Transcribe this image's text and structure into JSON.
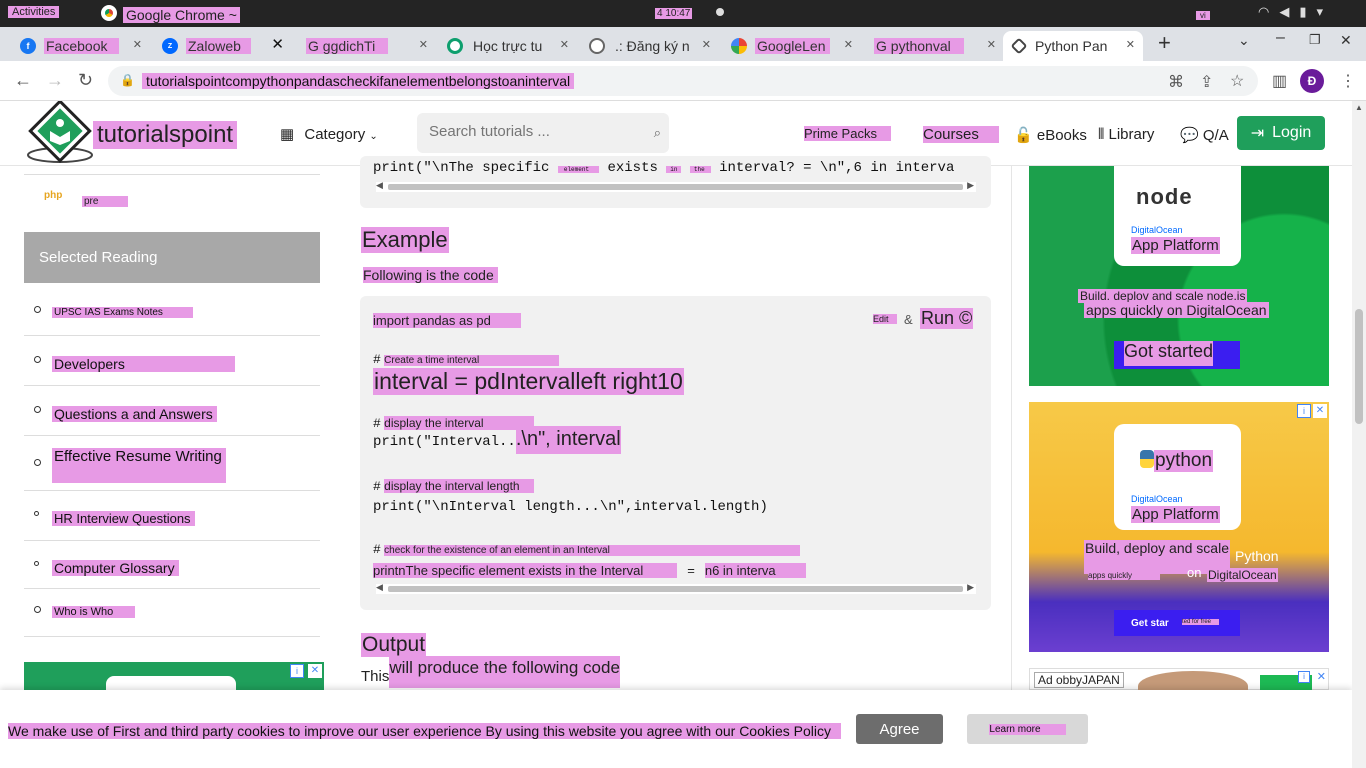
{
  "system": {
    "activities": "Activities",
    "app_name": "Google Chrome ~",
    "clock": "4 10:47",
    "keyboard": "vi"
  },
  "tabs": [
    {
      "title": "Facebook",
      "icon": "facebook-icon",
      "color": "#1877f2",
      "glyph": "f"
    },
    {
      "title": "Zaloweb",
      "icon": "zalo-icon",
      "color": "#0068ff",
      "glyph": "Z"
    },
    {
      "title": "G ggdichTi",
      "icon": "google-translate-icon",
      "color": "#4285f4",
      "glyph": ""
    },
    {
      "title": "Học trực tu",
      "icon": "course-site-icon",
      "color": "#0e9f6e",
      "glyph": ""
    },
    {
      "title": ".: Đăng ký n",
      "icon": "globe-icon",
      "color": "#666666",
      "glyph": ""
    },
    {
      "title": "GoogleLen",
      "icon": "google-lens-icon",
      "color": "#ea4335",
      "glyph": ""
    },
    {
      "title": "G pythonval",
      "icon": "google-search-icon",
      "color": "#4285f4",
      "glyph": ""
    },
    {
      "title": "Python Pan",
      "icon": "tutorialspoint-icon",
      "color": "#444444",
      "glyph": ""
    }
  ],
  "address": {
    "url": "tutorialspointcompythonpandascheckifanelementbelongstoaninterval",
    "avatar_letter": "Đ"
  },
  "header": {
    "brand": "tutorialspoint",
    "category": "Category",
    "search_placeholder": "Search tutorials ...",
    "menu": {
      "prime_packs": "Prime Packs",
      "courses": "Courses",
      "ebooks": "eBooks",
      "library": "Library",
      "qa": "Q/A",
      "login": "Login"
    }
  },
  "sidebar": {
    "php_label": "php",
    "pre_label": "pre",
    "heading": "Selected Reading",
    "items": [
      {
        "label": "UPSC IAS Exams Notes"
      },
      {
        "label": "Developers"
      },
      {
        "label": "Questions a and Answers"
      },
      {
        "label": "Effective Resume Writing"
      },
      {
        "label": "HR Interview Questions"
      },
      {
        "label": "Computer Glossary"
      },
      {
        "label": "Who is Who"
      }
    ]
  },
  "article": {
    "top_code": {
      "p1": "print(\"\\nThe specific ",
      "w1": "element",
      "p2": " exists ",
      "w2": "in",
      "p3": " ",
      "w3": "the",
      "p4": " interval? = \\n\",6 in interva"
    },
    "example_heading": "Example",
    "example_intro": "Following is the code",
    "code": {
      "import_line": "import pandas as pd",
      "edit": "Edit",
      "run": "Run ©",
      "comment1": "Create a time interval",
      "line2": "interval = pdIntervalleft right10",
      "comment2": "display the interval",
      "line3a": "print(\"Interval..",
      "line3b": ".\\n\", interval",
      "comment3": "display the interval length",
      "line4": "print(\"\\nInterval length...\\n\",interval.length)",
      "comment4": "check for the existence of an element in an Interval",
      "line5a": "printnThe specific element exists in the Interval",
      "line5b": "=",
      "line5c": "n6 in interva"
    },
    "output_heading": "Output",
    "output_intro_a": "This",
    "output_intro_b": "will produce the following code"
  },
  "ads": {
    "ad1": {
      "logo": "node",
      "company": "DigitalOcean",
      "product": "App Platform",
      "tagline1": "Build. deplov and scale node.is",
      "tagline2": "apps quickly on DigitalOcean",
      "cta": "Got started"
    },
    "ad2": {
      "logo": "python",
      "company": "DigitalOcean",
      "product": "App Platform",
      "tagline1": "Build, deploy and scale",
      "tagline_py": "Python",
      "tagline2": "apps quickly",
      "tagline_on": "on",
      "tagline3": "DigitalOcean",
      "cta_a": "Get star",
      "cta_b": "ted for free"
    },
    "ad3": {
      "label": "Ad obbyJAPAN"
    }
  },
  "cookie": {
    "message": "We make use of First and third party cookies to improve our user experience By using this website you agree with our Cookies Policy",
    "agree": "Agree",
    "learn_more": "Learn more"
  }
}
